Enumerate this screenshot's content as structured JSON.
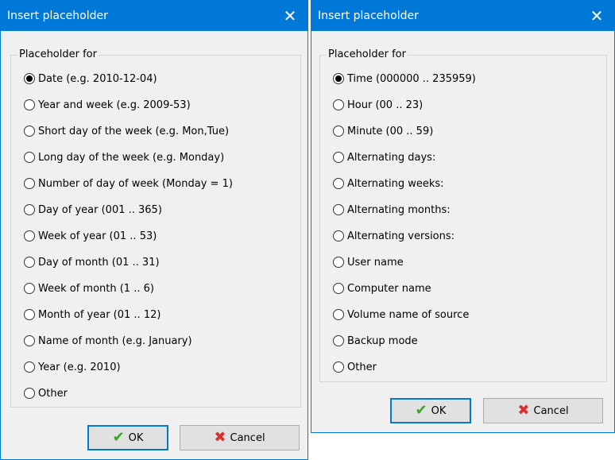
{
  "left_dialog": {
    "title": "Insert placeholder",
    "close_glyph": "✕",
    "group_label": "Placeholder for",
    "options": [
      {
        "label": "Date (e.g. 2010-12-04)",
        "checked": true
      },
      {
        "label": "Year and week (e.g. 2009-53)",
        "checked": false
      },
      {
        "label": "Short day of the week (e.g. Mon,Tue)",
        "checked": false
      },
      {
        "label": "Long day of the week (e.g. Monday)",
        "checked": false
      },
      {
        "label": "Number of day of week (Monday = 1)",
        "checked": false
      },
      {
        "label": "Day of year (001 .. 365)",
        "checked": false
      },
      {
        "label": "Week of year (01 .. 53)",
        "checked": false
      },
      {
        "label": "Day of month (01 .. 31)",
        "checked": false
      },
      {
        "label": "Week of month (1 .. 6)",
        "checked": false
      },
      {
        "label": "Month of year (01 .. 12)",
        "checked": false
      },
      {
        "label": "Name of month (e.g. January)",
        "checked": false
      },
      {
        "label": "Year (e.g. 2010)",
        "checked": false
      },
      {
        "label": "Other",
        "checked": false
      }
    ],
    "ok_label": "OK",
    "cancel_label": "Cancel"
  },
  "right_dialog": {
    "title": "Insert placeholder",
    "close_glyph": "✕",
    "group_label": "Placeholder for",
    "options": [
      {
        "label": "Time (000000 .. 235959)",
        "checked": true
      },
      {
        "label": "Hour (00 .. 23)",
        "checked": false
      },
      {
        "label": "Minute (00 .. 59)",
        "checked": false
      },
      {
        "label": "Alternating days:",
        "checked": false
      },
      {
        "label": "Alternating weeks:",
        "checked": false
      },
      {
        "label": "Alternating months:",
        "checked": false
      },
      {
        "label": "Alternating versions:",
        "checked": false
      },
      {
        "label": "User name",
        "checked": false
      },
      {
        "label": "Computer name",
        "checked": false
      },
      {
        "label": "Volume name of source",
        "checked": false
      },
      {
        "label": "Backup mode",
        "checked": false
      },
      {
        "label": "Other",
        "checked": false
      }
    ],
    "ok_label": "OK",
    "cancel_label": "Cancel"
  },
  "icons": {
    "ok": "checkmark-icon",
    "cancel": "cross-icon"
  },
  "colors": {
    "accent": "#0078d7",
    "ok_icon": "#3aa623",
    "cancel_icon": "#d8322f",
    "dialog_bg": "#f0f0f0"
  }
}
